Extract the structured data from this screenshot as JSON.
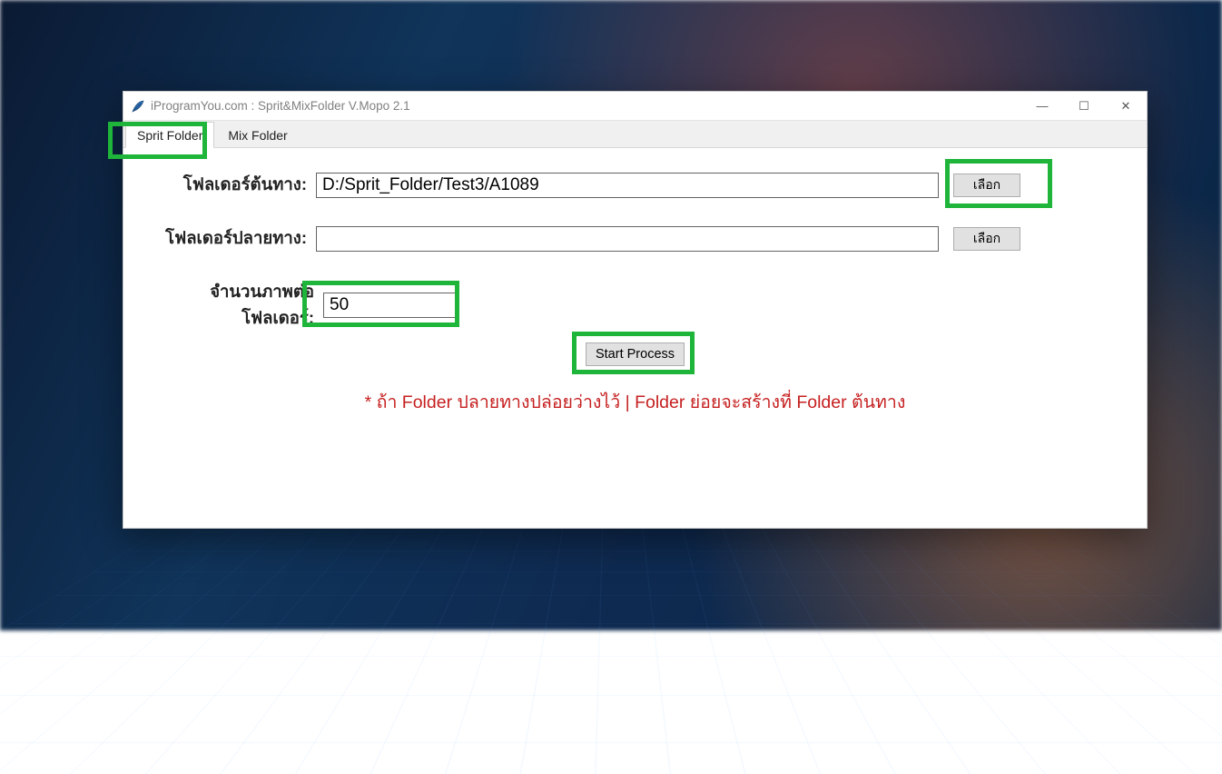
{
  "window": {
    "title": "iProgramYou.com : Sprit&MixFolder V.Mopo 2.1"
  },
  "tabs": [
    {
      "label": "Sprit Folder",
      "active": true
    },
    {
      "label": "Mix Folder",
      "active": false
    }
  ],
  "form": {
    "source_label": "โฟลเดอร์ต้นทาง:",
    "source_value": "D:/Sprit_Folder/Test3/A1089",
    "dest_label": "โฟลเดอร์ปลายทาง:",
    "dest_value": "",
    "count_label": "จำนวนภาพต่อโฟลเดอร์:",
    "count_value": "50",
    "browse_label": "เลือก",
    "start_label": "Start Process",
    "note": "* ถ้า Folder ปลายทางปล่อยว่างไว้ | Folder ย่อยจะสร้างที่ Folder ต้นทาง"
  },
  "winbtn": {
    "min": "—",
    "max": "☐",
    "close": "✕"
  }
}
